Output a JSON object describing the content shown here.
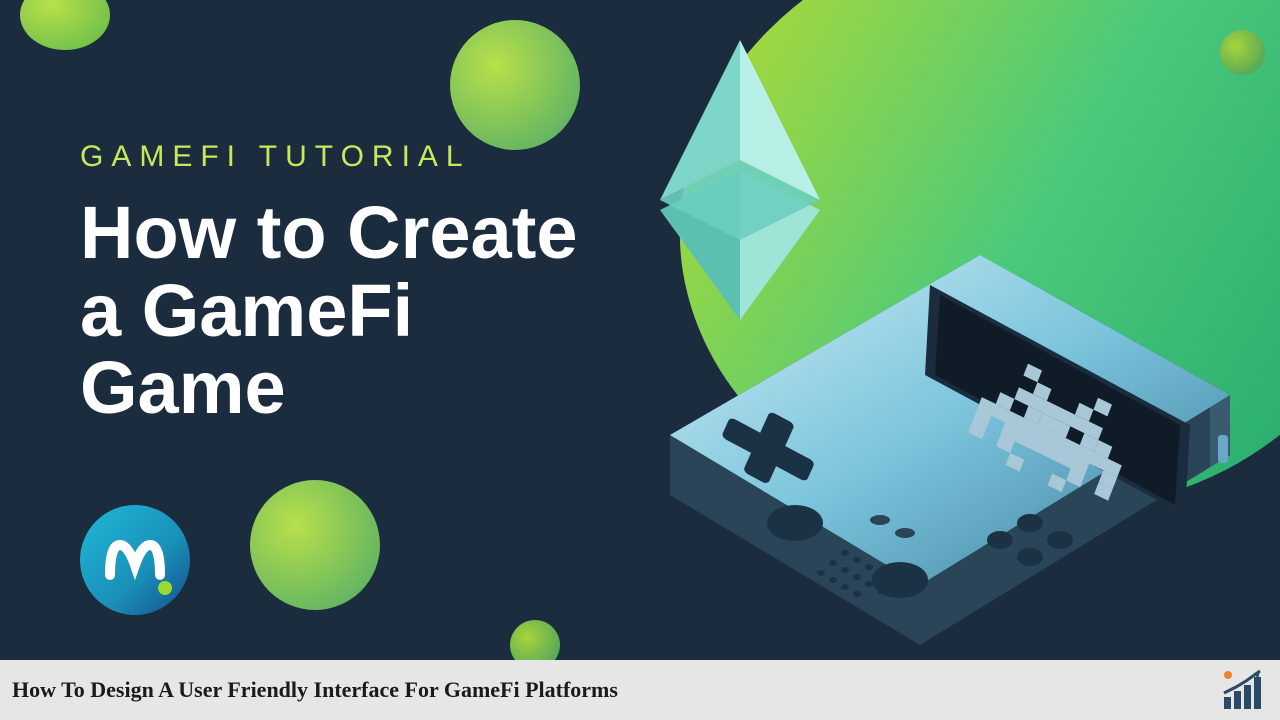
{
  "hero": {
    "kicker": "GAMEFI TUTORIAL",
    "title_line1": "How to Create",
    "title_line2": "a GameFi",
    "title_line3": "Game",
    "logo_label": "moralis-logo",
    "eth_label": "ethereum-diamond",
    "device_label": "handheld-game-console"
  },
  "caption": {
    "text": "How To Design A User Friendly Interface For GameFi Platforms",
    "icon_label": "growth-chart-icon"
  },
  "colors": {
    "bg": "#1a2c3e",
    "accent_green": "#a8d93a",
    "text_white": "#ffffff",
    "kicker_green": "#c8e85a"
  }
}
